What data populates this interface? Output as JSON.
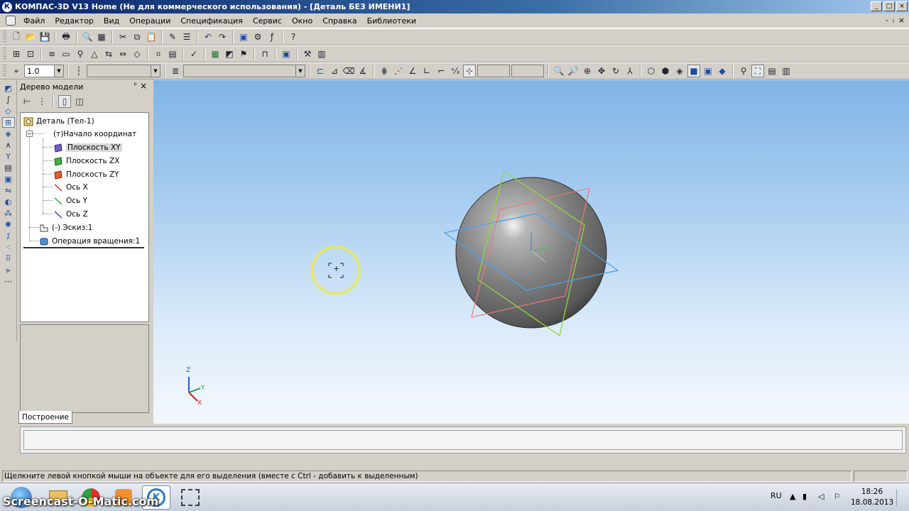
{
  "window": {
    "title": "КОМПАС-3D V13 Home (Не для коммерческого использования) - [Деталь БЕЗ ИМЕНИ1]",
    "app_icon": "К",
    "buttons": [
      "_",
      "□",
      "×"
    ]
  },
  "menu": {
    "items": [
      "Файл",
      "Редактор",
      "Вид",
      "Операции",
      "Спецификация",
      "Сервис",
      "Окно",
      "Справка",
      "Библиотеки"
    ],
    "mdi_buttons": [
      "-",
      "ₗ",
      "×"
    ]
  },
  "toolbar3": {
    "scale_value": "1.0"
  },
  "model_tree": {
    "title": "Дерево модели",
    "pin": "ᵖ",
    "close": "×",
    "items": [
      {
        "label": "Деталь (Тел-1)",
        "icon": "part-icon"
      },
      {
        "label": "(т)Начало координат",
        "icon": "origin-icon"
      },
      {
        "label": "Плоскость XY",
        "icon": "plane-xy-icon",
        "selected": true
      },
      {
        "label": "Плоскость ZX",
        "icon": "plane-zx-icon"
      },
      {
        "label": "Плоскость ZY",
        "icon": "plane-zy-icon"
      },
      {
        "label": "Ось X",
        "icon": "axis-x-icon"
      },
      {
        "label": "Ось Y",
        "icon": "axis-y-icon"
      },
      {
        "label": "Ось Z",
        "icon": "axis-z-icon"
      },
      {
        "label": "(-) Эскиз:1",
        "icon": "sketch-icon"
      },
      {
        "label": "Операция вращения:1",
        "icon": "revolve-icon"
      }
    ],
    "tab": "Построение"
  },
  "viewport": {
    "axis_labels": {
      "z": "Z",
      "y": "Y",
      "x": "X"
    },
    "cursor_symbol": "+"
  },
  "statusbar": {
    "hint": "Щелкните левой кнопкой мыши на объекте для его выделения (вместе с Ctrl - добавить к выделенным)"
  },
  "taskbar": {
    "language": "RU",
    "time": "18:26",
    "date": "18.08.2013"
  },
  "watermark": "Screencast-O-Matic.com",
  "colors": {
    "accent": "#0a246a",
    "highlight_ring": "#e8e85a",
    "plane_xy": "#4a9ae0",
    "plane_zx": "#8ad030",
    "plane_zy": "#e07070"
  }
}
